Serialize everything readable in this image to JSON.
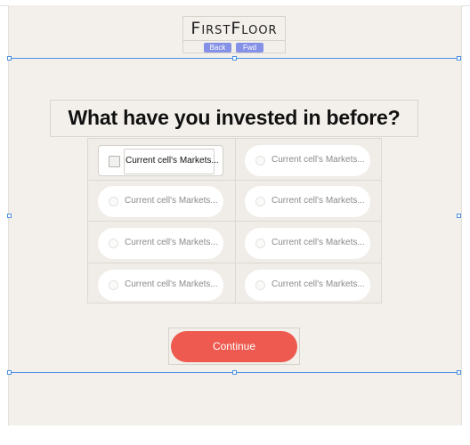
{
  "app": {
    "logo_text": "FirstFloor",
    "nav": {
      "back_label": "Back",
      "fwd_label": "Fwd"
    }
  },
  "question": {
    "title": "What have you invested in before?"
  },
  "options": [
    {
      "label": "Current cell's Markets...",
      "active": true
    },
    {
      "label": "Current cell's Markets...",
      "active": false
    },
    {
      "label": "Current cell's Markets...",
      "active": false
    },
    {
      "label": "Current cell's Markets...",
      "active": false
    },
    {
      "label": "Current cell's Markets...",
      "active": false
    },
    {
      "label": "Current cell's Markets...",
      "active": false
    },
    {
      "label": "Current cell's Markets...",
      "active": false
    },
    {
      "label": "Current cell's Markets...",
      "active": false
    }
  ],
  "actions": {
    "continue_label": "Continue"
  },
  "colors": {
    "accent": "#ee5a4f",
    "nav_button": "#8591e6",
    "selection": "#4a90e2",
    "background": "#f3f0eb"
  }
}
